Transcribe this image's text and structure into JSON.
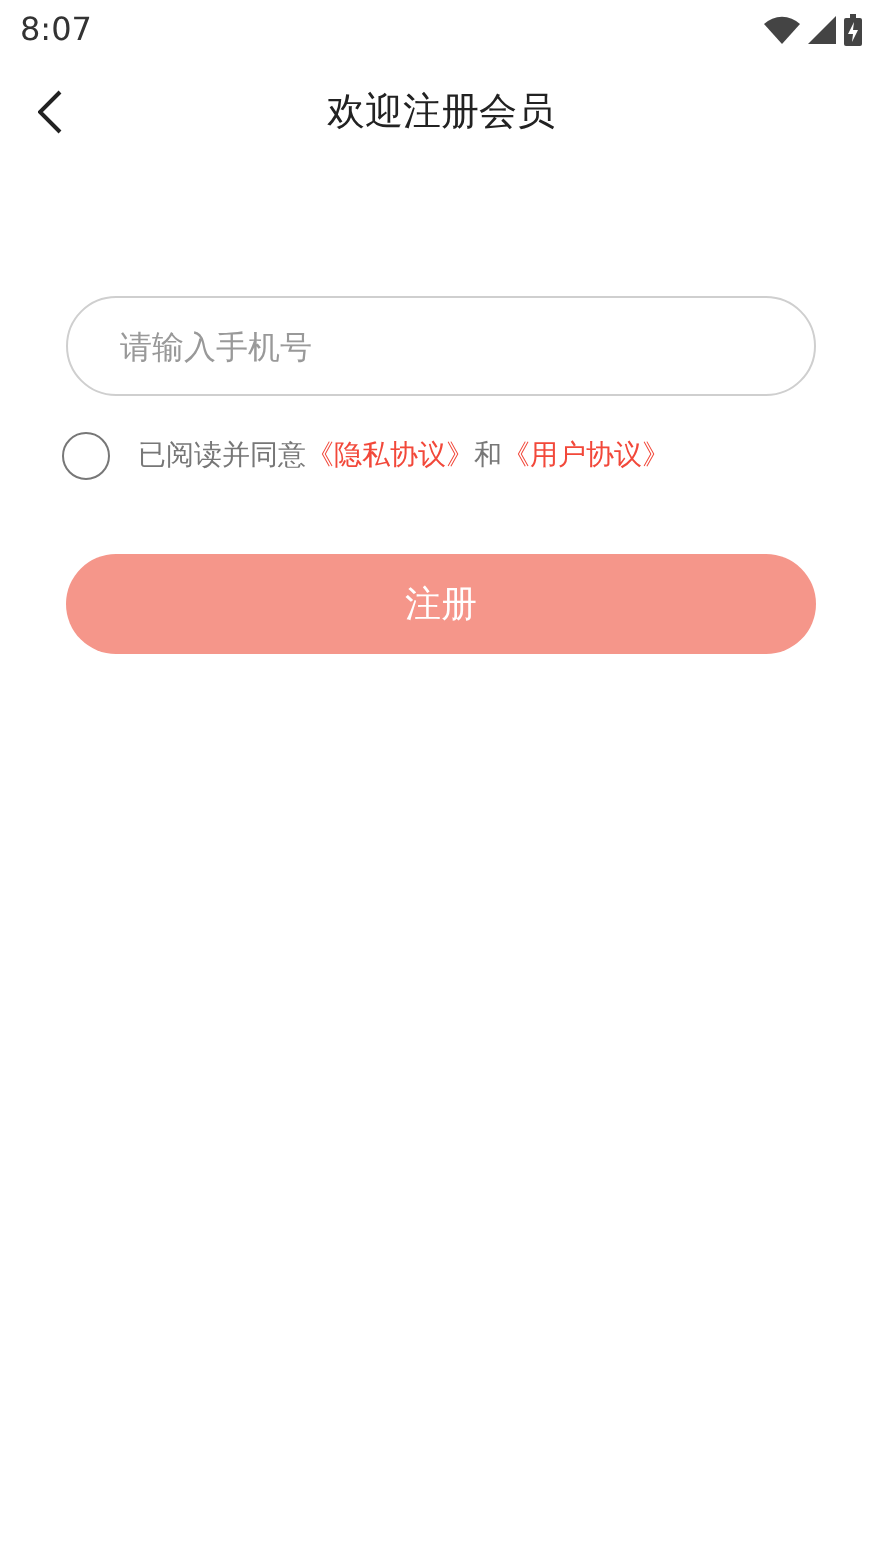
{
  "status_bar": {
    "time": "8:07"
  },
  "header": {
    "title": "欢迎注册会员"
  },
  "phone_field": {
    "placeholder": "请输入手机号"
  },
  "agreement": {
    "checked": false,
    "prefix": "已阅读并同意",
    "privacy_link": "《隐私协议》",
    "joiner": "和",
    "user_link": "《用户协议》"
  },
  "register_button": {
    "label": "注册",
    "disabled": true
  }
}
